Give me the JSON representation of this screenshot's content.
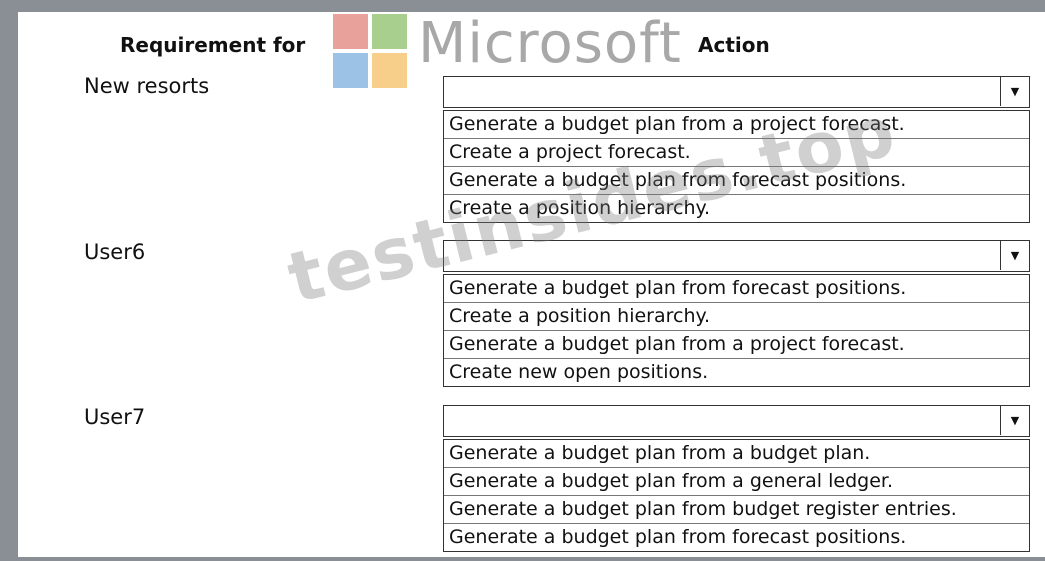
{
  "headers": {
    "requirement": "Requirement for",
    "action": "Action"
  },
  "logo_text": "Microsoft",
  "watermark": "testinsides.top",
  "colors": {
    "logo_red": "#e8a29b",
    "logo_green": "#a8cf8e",
    "logo_blue": "#9cc3e6",
    "logo_yellow": "#f8cf8a"
  },
  "rows": [
    {
      "label": "New resorts",
      "options": [
        "Generate a budget plan from a project forecast.",
        "Create a project forecast.",
        "Generate a budget plan from forecast positions.",
        "Create a position hierarchy."
      ]
    },
    {
      "label": "User6",
      "options": [
        "Generate a budget plan from forecast positions.",
        "Create a position hierarchy.",
        "Generate a budget plan from a project forecast.",
        "Create new open positions."
      ]
    },
    {
      "label": "User7",
      "options": [
        "Generate a budget plan from a budget plan.",
        "Generate a budget plan from a general ledger.",
        "Generate a budget plan from budget register entries.",
        "Generate a budget plan from forecast positions."
      ]
    }
  ]
}
